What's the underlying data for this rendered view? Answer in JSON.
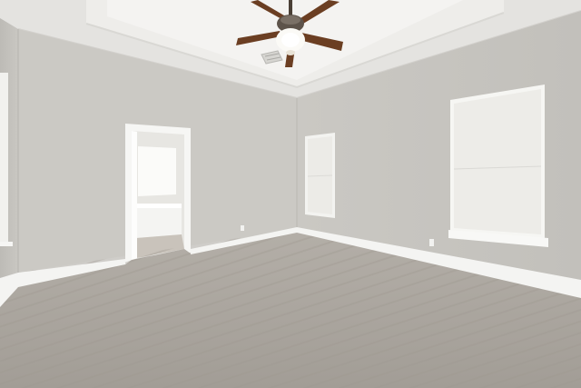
{
  "scene": {
    "subject": "empty-bedroom",
    "elements": [
      "tray-ceiling",
      "ceiling-fan",
      "air-vent",
      "left-wall",
      "back-wall",
      "right-wall",
      "doorway-to-bathroom",
      "small-window",
      "large-window",
      "window-shades",
      "baseboards",
      "outlets",
      "carpet-floor"
    ],
    "colors": {
      "wall": "#cbc9c4",
      "wall_shadow": "#bcbab5",
      "ceiling": "#e9e8e5",
      "tray_ceiling": "#f3f2f0",
      "trim": "#f6f6f4",
      "carpet": "#a9a49d",
      "window_shade": "#eeeeea",
      "fan_blade": "#6b3e22",
      "fan_light": "#fbfaf6"
    }
  }
}
